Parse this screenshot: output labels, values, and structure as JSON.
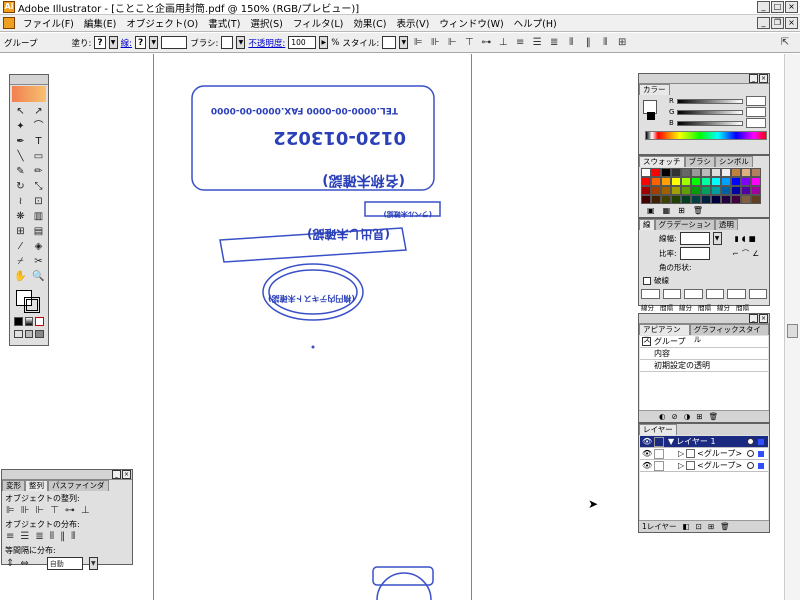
{
  "window": {
    "title": "Adobe Illustrator - [ことこと企画用封筒.pdf @ 150% (RGB/プレビュー)]",
    "menu": [
      "ファイル(F)",
      "編集(E)",
      "オブジェクト(O)",
      "書式(T)",
      "選択(S)",
      "フィルタ(L)",
      "効果(C)",
      "表示(V)",
      "ウィンドウ(W)",
      "ヘルプ(H)"
    ]
  },
  "control_bar": {
    "selection_label": "グループ",
    "fill_label": "塗り:",
    "fill_value": "?",
    "stroke_label": "線:",
    "stroke_value": "?",
    "brush_label": "ブラシ:",
    "opacity_label": "不透明度:",
    "opacity_value": "100",
    "opacity_unit": "%",
    "style_label": "スタイル:"
  },
  "align_panel": {
    "tabs": [
      "変形",
      "整列",
      "パスファインダ"
    ],
    "active_tab": "整列",
    "sec_align": "オブジェクトの整列:",
    "sec_distribute": "オブジェクトの分布:",
    "sec_spacing": "等間隔に分布:",
    "spacing_value": "自動"
  },
  "color_panel": {
    "title": "カラー",
    "channels": [
      "R",
      "G",
      "B"
    ]
  },
  "swatch_panel": {
    "tabs": [
      "スウォッチ",
      "ブラシ",
      "シンボル"
    ],
    "colors": [
      "#ffffff",
      "#ff0000",
      "#000000",
      "#333333",
      "#666666",
      "#999999",
      "#bbbbbb",
      "#dddddd",
      "#eeeeee",
      "#c08040",
      "#e0b080",
      "#b08060",
      "#ff0000",
      "#ff6000",
      "#ffa000",
      "#ffff00",
      "#a0ff00",
      "#00ff00",
      "#00ffa0",
      "#00ffff",
      "#00a0ff",
      "#0000ff",
      "#8000ff",
      "#ff00ff",
      "#a00000",
      "#a04000",
      "#a06000",
      "#a0a000",
      "#60a000",
      "#00a000",
      "#00a060",
      "#00a0a0",
      "#0060a0",
      "#0000a0",
      "#5000a0",
      "#a000a0",
      "#400000",
      "#402000",
      "#404000",
      "#204000",
      "#004020",
      "#004040",
      "#002040",
      "#000040",
      "#200040",
      "#400040",
      "#806040",
      "#604020"
    ]
  },
  "stroke_panel": {
    "tabs": [
      "線",
      "グラデーション",
      "透明"
    ],
    "weight_label": "線幅:",
    "cap_label": "線端:",
    "join_label": "角の形状:",
    "limit_label": "比率:",
    "dashed_label": "破線",
    "dash_labels": [
      "線分",
      "間隔",
      "線分",
      "間隔",
      "線分",
      "間隔"
    ]
  },
  "appearance_panel": {
    "tabs": [
      "アピアランス",
      "グラフィックスタイル"
    ],
    "header": "グループ",
    "rows": [
      "内容",
      "初期設定の透明"
    ]
  },
  "layers_panel": {
    "title": "レイヤー",
    "rows": [
      {
        "name": "レイヤー 1",
        "selected": true,
        "indent": 0
      },
      {
        "name": "<グループ>",
        "selected": false,
        "indent": 1
      },
      {
        "name": "<グループ>",
        "selected": false,
        "indent": 1
      }
    ],
    "footer": "1レイヤー"
  },
  "artwork": {
    "phone": "0120-013022",
    "tel_line": "TEL.0000-00-0000 FAX.0000-00-0000",
    "shop_name": "(名称未確認)",
    "banner": "(ラベル未確認)",
    "heading": "(見出し未確認)",
    "oval_text": "(楕円内テキスト未確認)"
  }
}
